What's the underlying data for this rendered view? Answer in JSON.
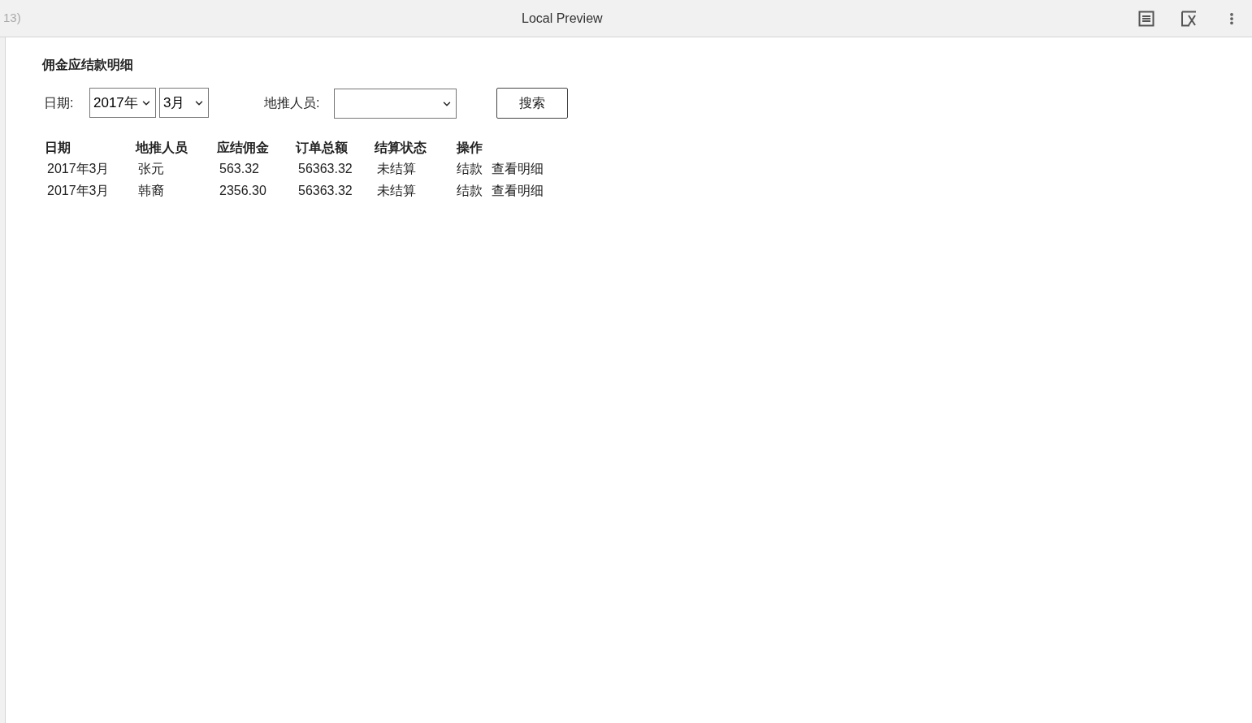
{
  "window": {
    "title": "Local Preview",
    "title_prefix": "13)"
  },
  "page": {
    "heading": "佣金应结款明细"
  },
  "filters": {
    "date_label": "日期:",
    "year": "2017年",
    "month": "3月",
    "person_label": "地推人员:",
    "search_button": "搜索"
  },
  "table": {
    "columns": [
      "日期",
      "地推人员",
      "应结佣金",
      "订单总额",
      "结算状态",
      "操作"
    ],
    "rows": [
      {
        "date": "2017年3月",
        "person": "张元",
        "commission": "563.32",
        "total": "56363.32",
        "status": "未结算",
        "actions": [
          "结款",
          "查看明细"
        ]
      },
      {
        "date": "2017年3月",
        "person": "韩裔",
        "commission": "2356.30",
        "total": "56363.32",
        "status": "未结算",
        "actions": [
          "结款",
          "查看明细"
        ]
      }
    ]
  }
}
